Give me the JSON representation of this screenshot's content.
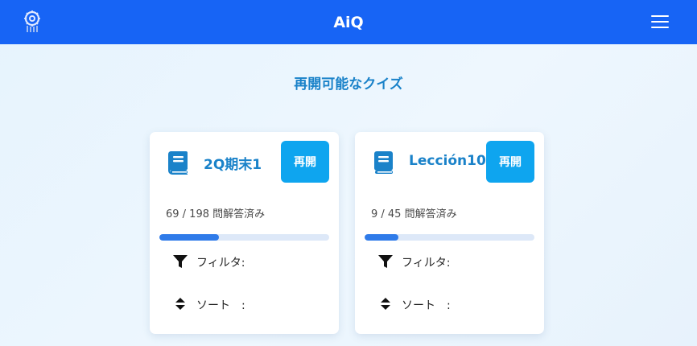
{
  "header": {
    "title": "AiQ",
    "logo_icon": "brain-gear-logo",
    "menu_icon": "hamburger-menu-icon",
    "bg_color": "#1764f5"
  },
  "page": {
    "heading": "再開可能なクイズ"
  },
  "quizzes": [
    {
      "title": "2Q期末1",
      "resume_label": "再開",
      "progress_text": "69 / 198 問解答済み",
      "answered": 69,
      "total": 198,
      "filter_label": "フィルタ:",
      "sort_label": "ソート　:"
    },
    {
      "title": "Lección10",
      "resume_label": "再開",
      "progress_text": "9 / 45 問解答済み",
      "answered": 9,
      "total": 45,
      "filter_label": "フィルタ:",
      "sort_label": "ソート　:"
    }
  ],
  "colors": {
    "accent": "#1a82c9",
    "button": "#0ea5ef",
    "progress": "#2f7be9",
    "progress_track": "#dde8f8"
  }
}
